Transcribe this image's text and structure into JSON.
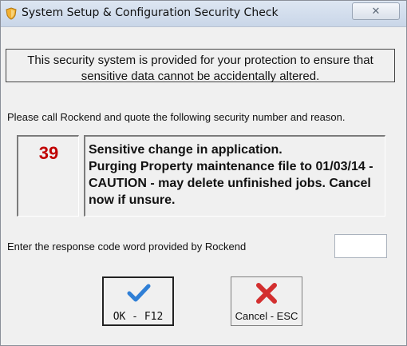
{
  "window": {
    "title": "System Setup & Configuration Security Check",
    "close_label": "✕"
  },
  "notice": {
    "text": "This security system is provided for your protection to ensure that sensitive data cannot be accidentally altered."
  },
  "instruction": {
    "text": "Please call Rockend and quote the following security number and reason."
  },
  "security": {
    "number": "39",
    "reason": "Sensitive change in application.\nPurging Property maintenance file to 01/03/14 - CAUTION - may delete unfinished jobs. Cancel now if unsure."
  },
  "response": {
    "label": "Enter the response code word provided by Rockend",
    "value": ""
  },
  "buttons": {
    "ok_label": "OK - F12",
    "cancel_label": "Cancel - ESC"
  },
  "colors": {
    "security_number": "#c00000",
    "ok_check": "#2f7fd6",
    "cancel_x": "#d32f2f"
  },
  "icons": {
    "title": "shield-icon",
    "ok": "checkmark-icon",
    "cancel": "red-x-icon"
  }
}
